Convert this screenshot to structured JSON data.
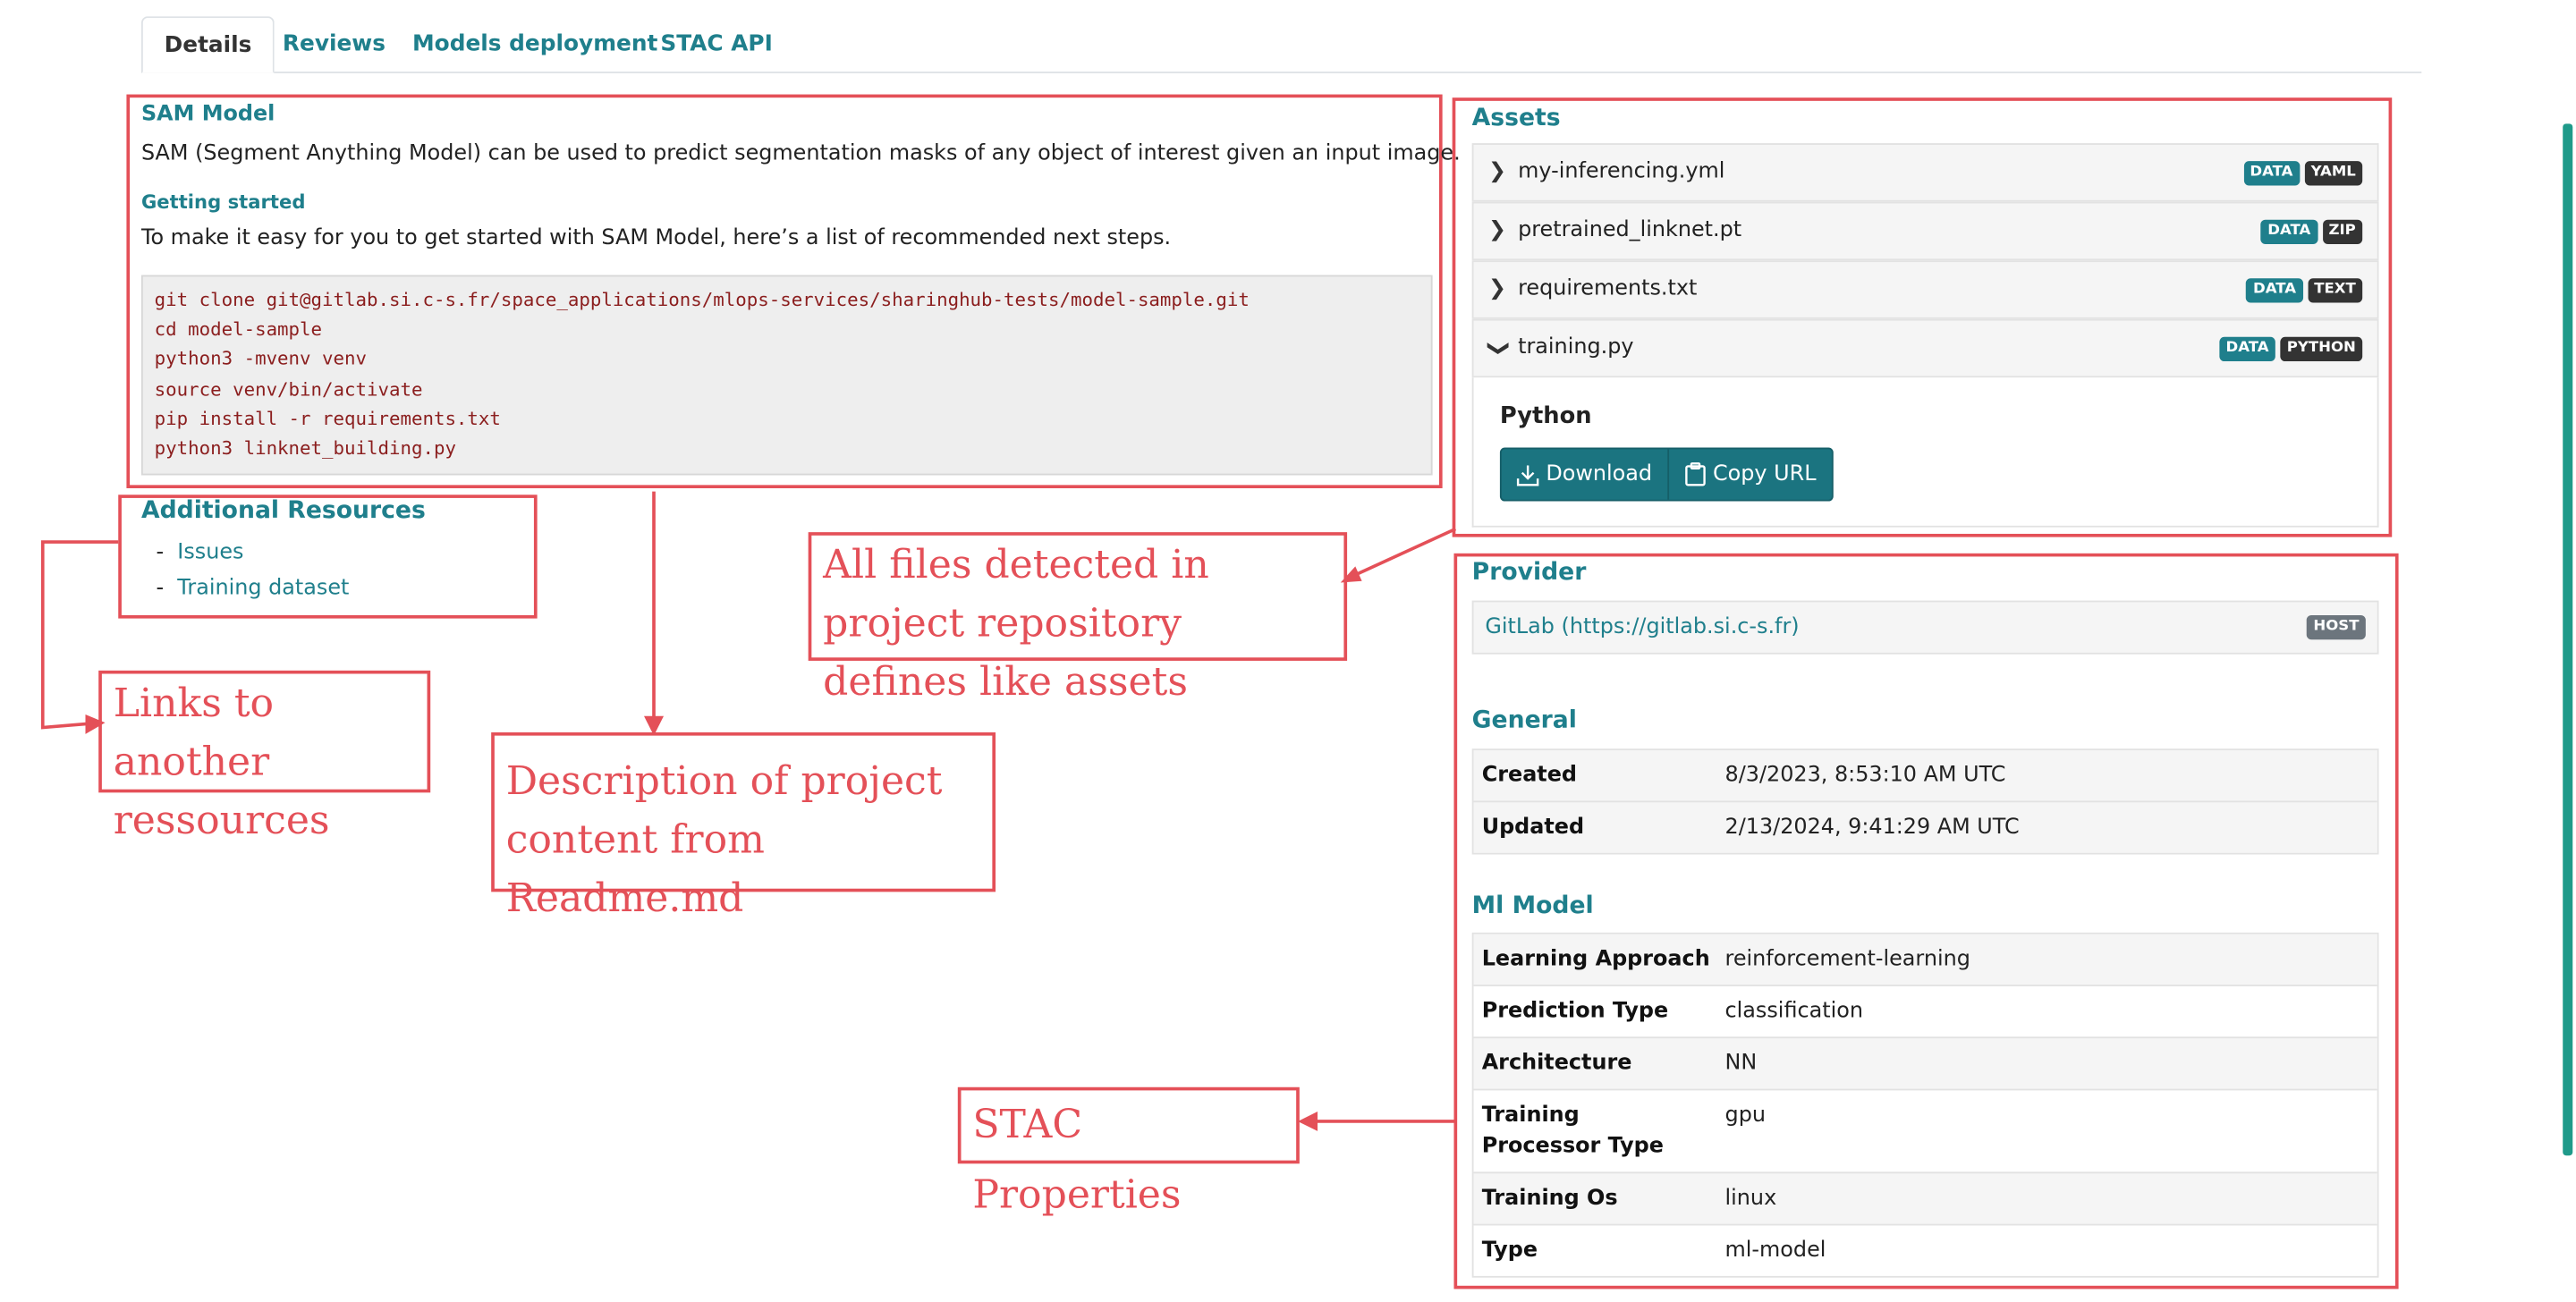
{
  "tabs": [
    "Details",
    "Reviews",
    "Models deployment",
    "STAC API"
  ],
  "readme": {
    "title": "SAM Model",
    "description": "SAM (Segment Anything Model) can be used to predict segmentation masks of any object of interest given an input image.",
    "getting_started_title": "Getting started",
    "getting_started_text": "To make it easy for you to get started with SAM Model, here’s a list of recommended next steps.",
    "code_lines": [
      "git clone git@gitlab.si.c-s.fr/space_applications/mlops-services/sharinghub-tests/model-sample.git",
      "cd model-sample",
      "python3 -mvenv venv",
      "source venv/bin/activate",
      "pip install -r requirements.txt",
      "python3 linknet_building.py"
    ]
  },
  "additional_resources": {
    "title": "Additional Resources",
    "items": [
      {
        "bullet": "-",
        "label": "Issues"
      },
      {
        "bullet": "-",
        "label": "Training dataset"
      }
    ]
  },
  "assets": {
    "title": "Assets",
    "items": [
      {
        "name": "my-inferencing.yml",
        "badges": [
          "DATA",
          "YAML"
        ],
        "expanded": false
      },
      {
        "name": "pretrained_linknet.pt",
        "badges": [
          "DATA",
          "ZIP"
        ],
        "expanded": false
      },
      {
        "name": "requirements.txt",
        "badges": [
          "DATA",
          "TEXT"
        ],
        "expanded": false
      },
      {
        "name": "training.py",
        "badges": [
          "DATA",
          "PYTHON"
        ],
        "expanded": true
      }
    ],
    "expanded_title": "Python",
    "download_label": "Download",
    "copy_url_label": "Copy URL"
  },
  "provider": {
    "title": "Provider",
    "link": "GitLab (https://gitlab.si.c-s.fr)",
    "badge": "HOST"
  },
  "general": {
    "title": "General",
    "rows": [
      {
        "key": "Created",
        "value": "8/3/2023, 8:53:10 AM UTC"
      },
      {
        "key": "Updated",
        "value": "2/13/2024, 9:41:29 AM UTC"
      }
    ]
  },
  "ml_model": {
    "title": "Ml Model",
    "rows": [
      {
        "key": "Learning Approach",
        "value": "reinforcement-learning"
      },
      {
        "key": "Prediction Type",
        "value": "classification"
      },
      {
        "key": "Architecture",
        "value": "NN"
      },
      {
        "key": "Training Processor Type",
        "value": "gpu"
      },
      {
        "key": "Training Os",
        "value": "linux"
      },
      {
        "key": "Type",
        "value": "ml-model"
      }
    ]
  },
  "annotations": {
    "links": "Links to another ressources",
    "description": "Description of project content from Readme.md",
    "assets": "All files detected in project repository defines like assets",
    "stac": "STAC Properties"
  },
  "colors": {
    "accent": "#1f7f8c",
    "annotation": "#e45058",
    "button": "#1b7480"
  }
}
